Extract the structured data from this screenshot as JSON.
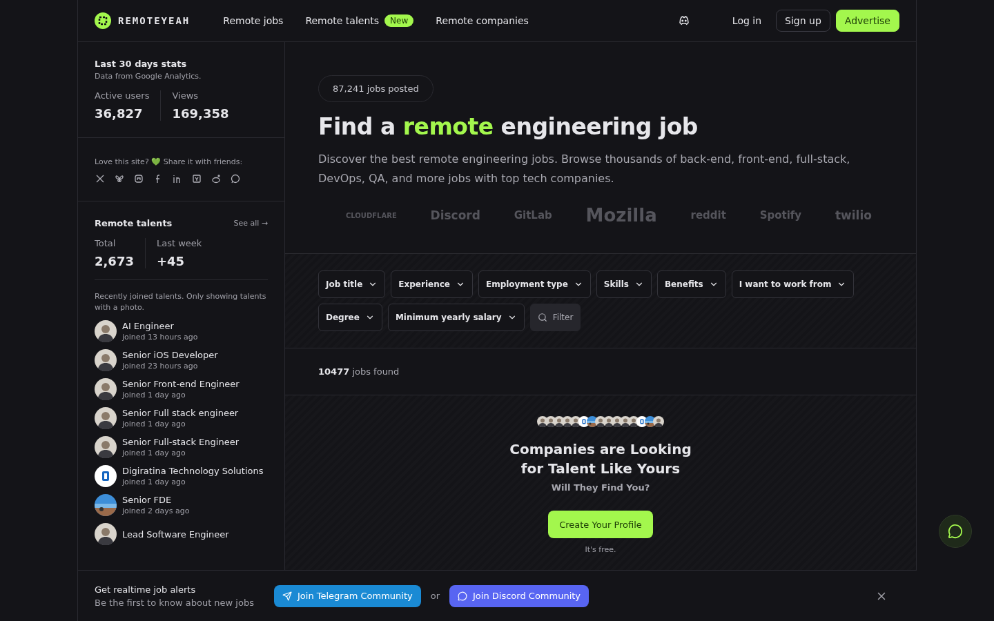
{
  "header": {
    "brand": "REMOTEYEAH",
    "nav": [
      {
        "label": "Remote jobs"
      },
      {
        "label": "Remote talents",
        "badge": "New"
      },
      {
        "label": "Remote companies"
      }
    ],
    "login": "Log in",
    "signup": "Sign up",
    "advertise": "Advertise"
  },
  "sidebar": {
    "stats": {
      "title": "Last 30 days stats",
      "subtitle": "Data from Google Analytics.",
      "items": [
        {
          "label": "Active users",
          "value": "36,827"
        },
        {
          "label": "Views",
          "value": "169,358"
        }
      ]
    },
    "share": {
      "text": "Love this site? 💚 Share it with friends:"
    },
    "talents": {
      "title": "Remote talents",
      "see_all": "See all →",
      "items": [
        {
          "label": "Total",
          "value": "2,673"
        },
        {
          "label": "Last week",
          "value": "+45"
        }
      ],
      "note": "Recently joined talents. Only showing talents with a photo.",
      "people": [
        {
          "title": "AI Engineer",
          "joined": "joined 13 hours ago",
          "kind": "person"
        },
        {
          "title": "Senior iOS Developer",
          "joined": "joined 23 hours ago",
          "kind": "person"
        },
        {
          "title": "Senior Front-end Engineer",
          "joined": "joined 1 day ago",
          "kind": "person"
        },
        {
          "title": "Senior Full stack engineer",
          "joined": "joined 1 day ago",
          "kind": "person"
        },
        {
          "title": "Senior Full-stack Engineer",
          "joined": "joined 1 day ago",
          "kind": "person"
        },
        {
          "title": "Digiratina Technology Solutions",
          "joined": "joined 1 day ago",
          "kind": "logo"
        },
        {
          "title": "Senior FDE",
          "joined": "joined 2 days ago",
          "kind": "picture"
        },
        {
          "title": "Lead Software Engineer",
          "kind": "person"
        }
      ]
    }
  },
  "hero": {
    "pill_count": "87,241",
    "pill_text": "jobs posted",
    "title_before": "Find a",
    "title_accent": "remote",
    "title_after": "engineering job",
    "description": "Discover the best remote engineering jobs. Browse thousands of back-end, front-end, full-stack, DevOps, QA, and more jobs with top tech companies.",
    "logos": [
      "CLOUDFLARE",
      "Discord",
      "GitLab",
      "Mozilla",
      "reddit",
      "Spotify",
      "twilio"
    ]
  },
  "filters": {
    "dropdowns": [
      "Job title",
      "Experience",
      "Employment type",
      "Skills",
      "Benefits",
      "I want to work from",
      "Degree",
      "Minimum yearly salary"
    ],
    "filter_button": "Filter"
  },
  "results": {
    "count": "10477",
    "text": "jobs found"
  },
  "promo": {
    "title_line1": "Companies are Looking",
    "title_line2": "for Talent Like Yours",
    "subtitle": "Will They Find You?",
    "button": "Create Your Profile",
    "note": "It's free."
  },
  "alert_bar": {
    "title": "Get realtime job alerts",
    "subtitle": "Be the first to know about new jobs",
    "telegram": "Join Telegram Community",
    "or": "or",
    "discord": "Join Discord Community"
  }
}
